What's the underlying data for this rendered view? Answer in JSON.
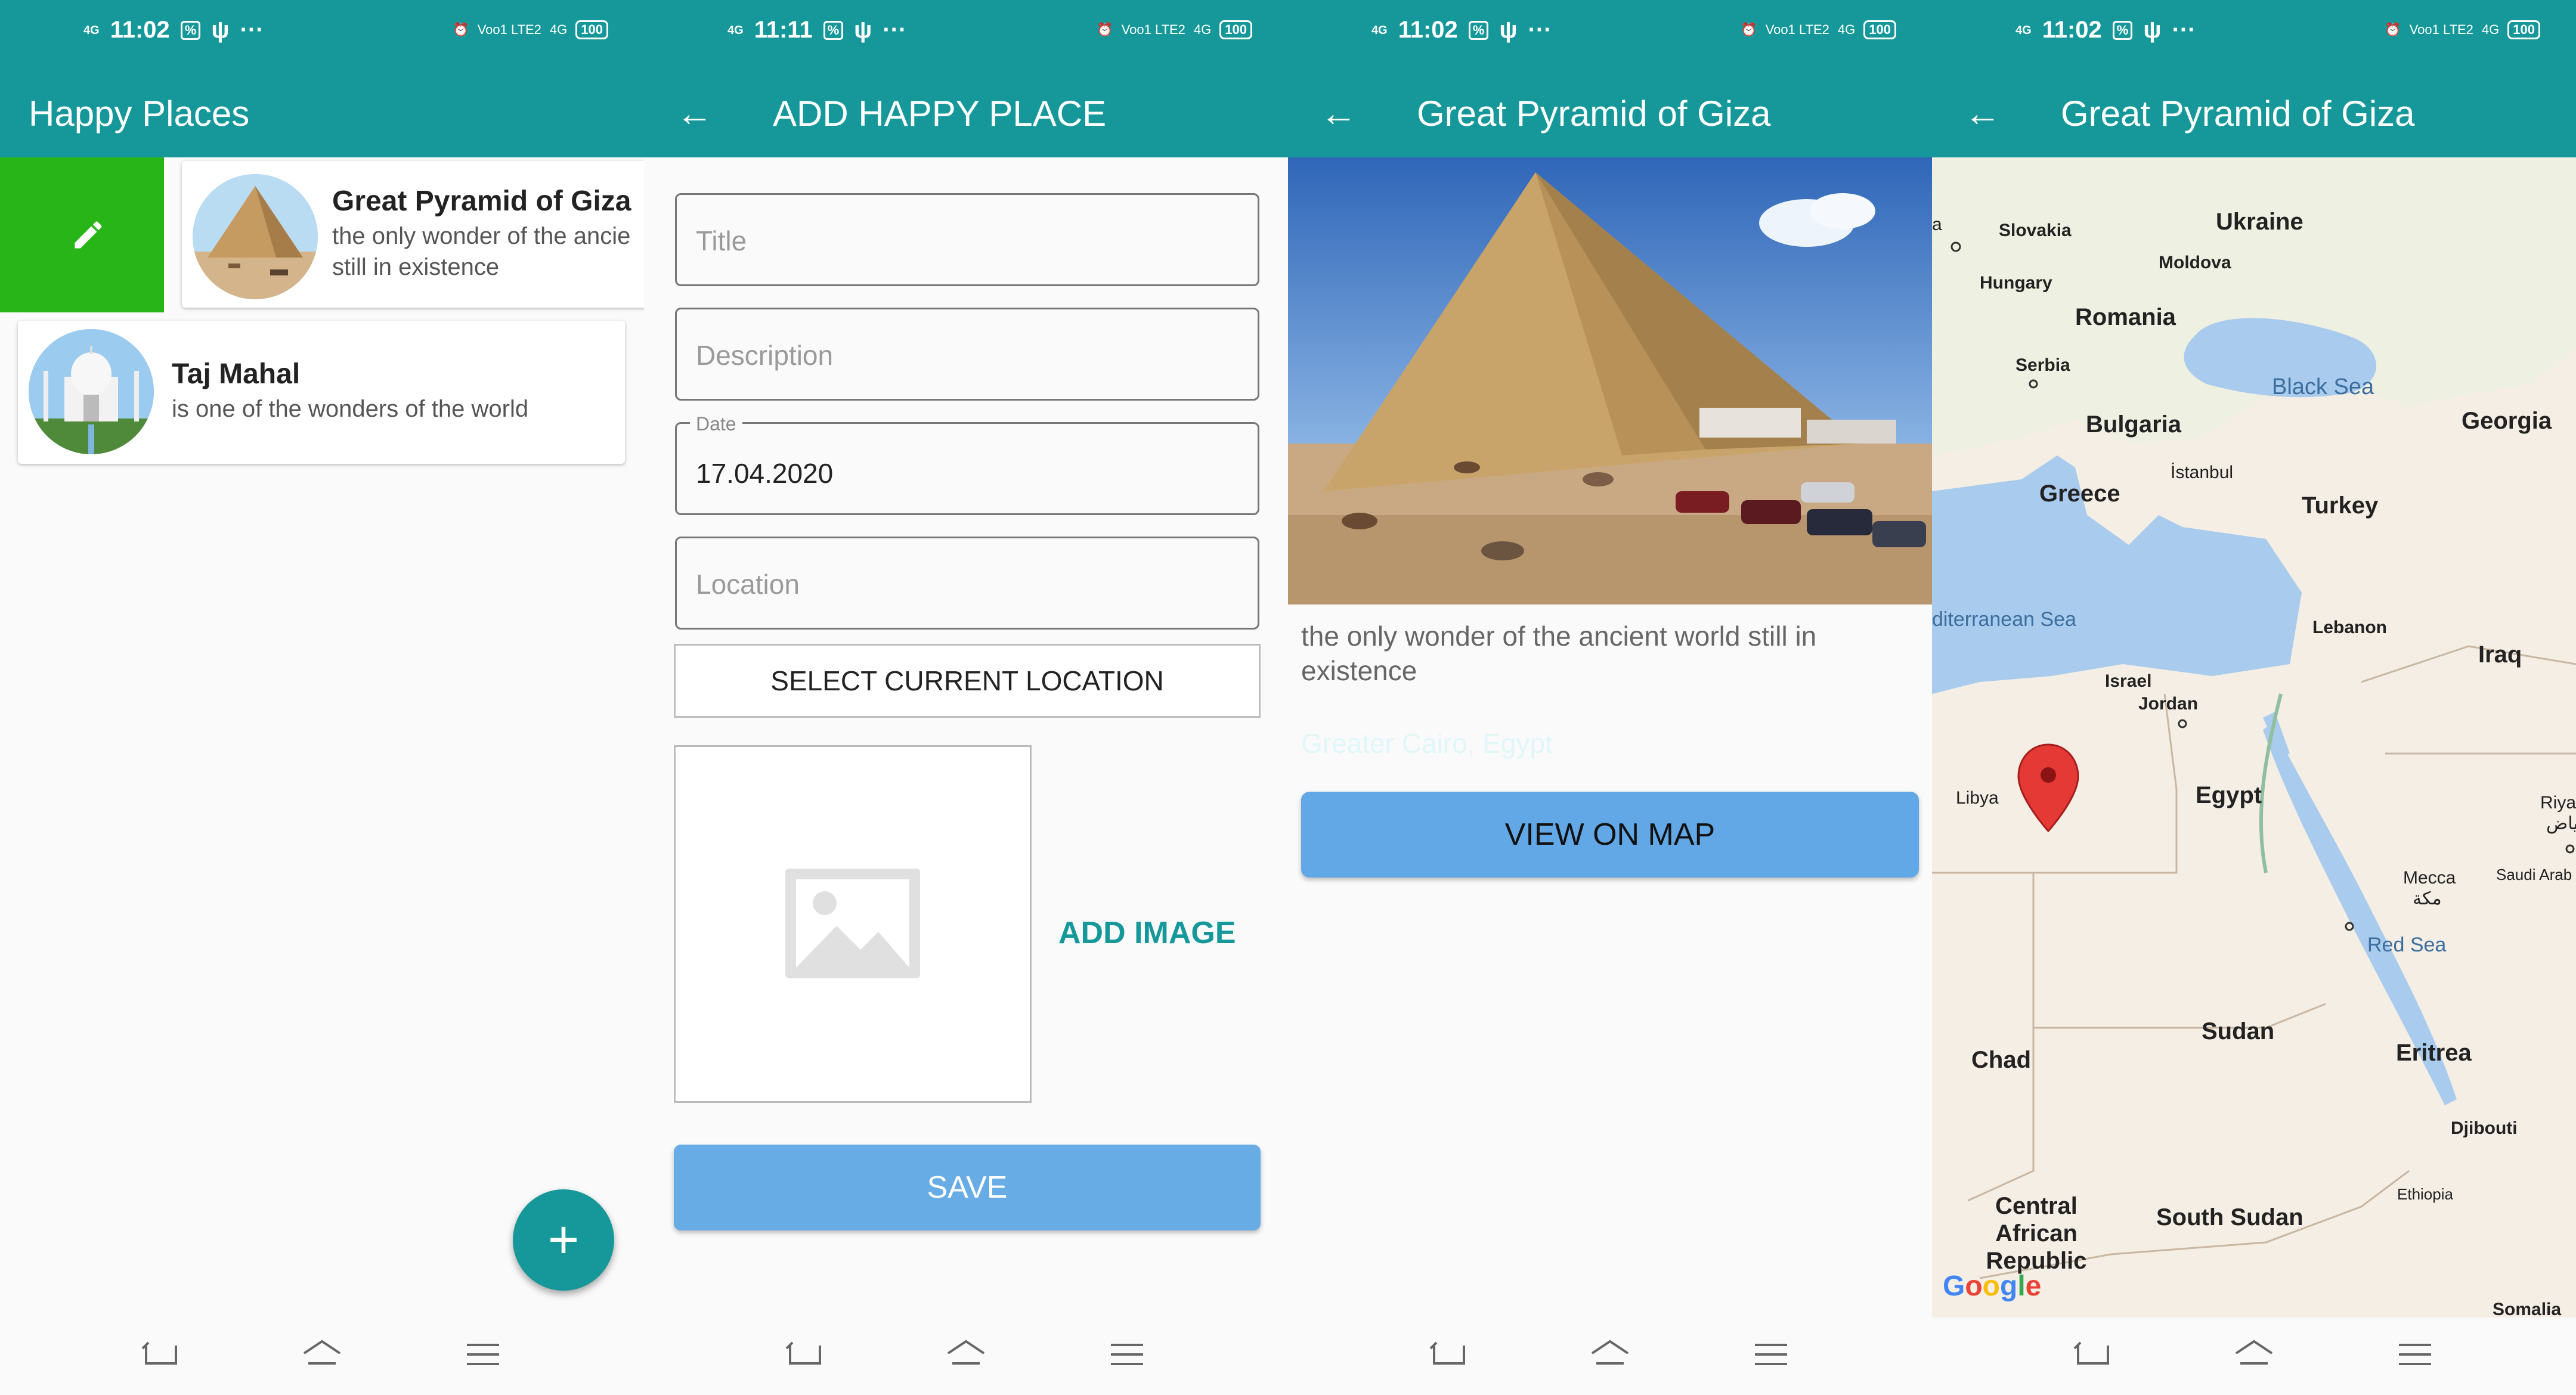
{
  "colors": {
    "teal": "#16989a",
    "edit_green": "#27b517",
    "save_blue": "#68ace5",
    "map_blue": "#63a8e6"
  },
  "screens": [
    {
      "status": {
        "time": "11:02",
        "net": "4G",
        "battery": "100",
        "carrier": "Voo1 LTE2",
        "signal2": "4G"
      },
      "appbar": {
        "title": "Happy Places"
      },
      "places": [
        {
          "title": "Great Pyramid of Giza",
          "description": "the only wonder of the ancie still in existence"
        },
        {
          "title": "Taj Mahal",
          "description": "is one of the wonders of the world"
        }
      ],
      "icons": {
        "edit": "pencil-icon",
        "fab": "plus-icon"
      },
      "fab_label": "+"
    },
    {
      "status": {
        "time": "11:11",
        "net": "4G",
        "battery": "100",
        "carrier": "Voo1 LTE2",
        "signal2": "4G"
      },
      "appbar": {
        "title": "ADD HAPPY PLACE"
      },
      "form": {
        "title_placeholder": "Title",
        "description_placeholder": "Description",
        "date_label": "Date",
        "date_value": "17.04.2020",
        "location_placeholder": "Location",
        "select_location_label": "SELECT CURRENT LOCATION",
        "add_image_label": "ADD IMAGE",
        "save_label": "SAVE"
      }
    },
    {
      "status": {
        "time": "11:02",
        "net": "4G",
        "battery": "100",
        "carrier": "Voo1 LTE2",
        "signal2": "4G"
      },
      "appbar": {
        "title": "Great Pyramid of Giza"
      },
      "detail": {
        "description": "the only wonder of the ancient world still in existence",
        "location": "Greater Cairo, Egypt",
        "view_on_map_label": "VIEW ON MAP"
      }
    },
    {
      "status": {
        "time": "11:02",
        "net": "4G",
        "battery": "100",
        "carrier": "Voo1 LTE2",
        "signal2": "4G"
      },
      "appbar": {
        "title": "Great Pyramid of Giza"
      },
      "map": {
        "labels": {
          "slovakia": "Slovakia",
          "ukraine": "Ukraine",
          "moldova": "Moldova",
          "hungary": "Hungary",
          "romania": "Romania",
          "serbia": "Serbia",
          "black_sea": "Black Sea",
          "bulgaria": "Bulgaria",
          "georgia": "Georgia",
          "istanbul": "İstanbul",
          "greece": "Greece",
          "turkey": "Turkey",
          "med_sea": "diterranean Sea",
          "lebanon": "Lebanon",
          "iraq": "Iraq",
          "israel": "Israel",
          "jordan": "Jordan",
          "libya": "Libya",
          "egypt": "Egypt",
          "riya": "Riya",
          "riya_ar": "ياض",
          "mecca": "Mecca",
          "mecca_ar": "مكة",
          "saudi": "Saudi Arab",
          "red_sea": "Red Sea",
          "sudan": "Sudan",
          "chad": "Chad",
          "eritrea": "Eritrea",
          "djibouti": "Djibouti",
          "ethiopia": "Ethiopia",
          "car": "Central African Republic",
          "south_sudan": "South Sudan",
          "somalia": "Somalia",
          "a": "a",
          "google": "Google"
        }
      }
    }
  ]
}
